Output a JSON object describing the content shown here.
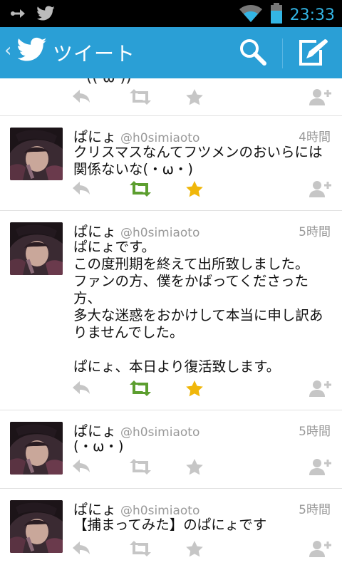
{
  "status_bar": {
    "time": "23:33"
  },
  "action_bar": {
    "title": "ツイート",
    "back_glyph": "‹"
  },
  "partial_tweet": {
    "text_tail": "・((   ω  ))"
  },
  "tweets": [
    {
      "name": "ぱにょ",
      "handle": "@h0simiaoto",
      "time": "4時間",
      "text": "クリスマスなんてフツメンのおいらには関係ないな(・ω・)",
      "retweeted": true,
      "favorited": true
    },
    {
      "name": "ぱにょ",
      "handle": "@h0simiaoto",
      "time": "5時間",
      "text": "ぱにょです。\nこの度刑期を終えて出所致しました。\nファンの方、僕をかばってくださった方、\n多大な迷惑をおかけして本当に申し訳ありませんでした。\n\nぱにょ、本日より復活致します。",
      "retweeted": true,
      "favorited": true
    },
    {
      "name": "ぱにょ",
      "handle": "@h0simiaoto",
      "time": "5時間",
      "text": "(・ω・)",
      "retweeted": false,
      "favorited": false
    },
    {
      "name": "ぱにょ",
      "handle": "@h0simiaoto",
      "time": "5時間",
      "text": "【捕まってみた】のぱにょです",
      "retweeted": false,
      "favorited": false
    }
  ],
  "colors": {
    "action_bar": "#2a9fd6",
    "retweet_active": "#5c9e2f",
    "favorite_active": "#f0b70a",
    "inactive_icon": "#c6c6c6"
  }
}
